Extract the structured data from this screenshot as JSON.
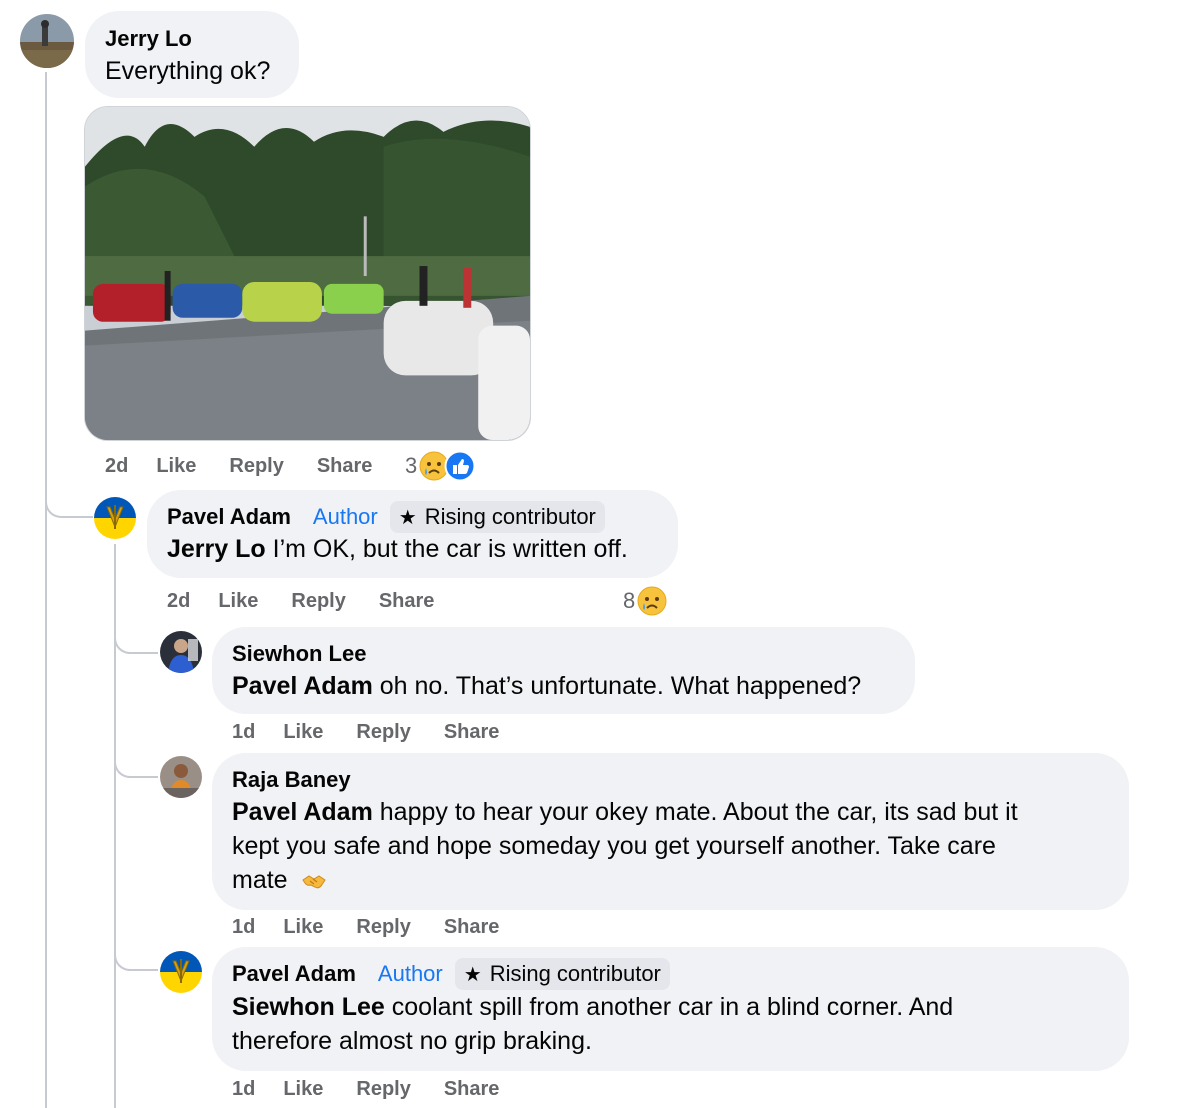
{
  "comments": [
    {
      "author": "Jerry Lo",
      "text": "Everything ok?",
      "time": "2d",
      "actions": [
        "Like",
        "Reply",
        "Share"
      ],
      "reaction_count": "3",
      "reactions": [
        "crying-face-icon",
        "like-icon"
      ]
    },
    {
      "author": "Pavel Adam",
      "author_tag": "Author",
      "badge": "Rising contributor",
      "mention": "Jerry Lo",
      "text": "I’m OK, but the car is written off.",
      "time": "2d",
      "actions": [
        "Like",
        "Reply",
        "Share"
      ],
      "reaction_count": "8",
      "reactions": [
        "crying-face-icon"
      ]
    },
    {
      "author": "Siewhon Lee",
      "mention": "Pavel Adam",
      "text": "oh no. That’s unfortunate. What happened?",
      "time": "1d",
      "actions": [
        "Like",
        "Reply",
        "Share"
      ]
    },
    {
      "author": "Raja Baney",
      "mention": "Pavel Adam",
      "text_lines": [
        "happy to hear your okey mate. About the car, its sad but it",
        "kept you safe and hope someday you get yourself another. Take care",
        "mate"
      ],
      "trailing_icon": "handshake-icon",
      "time": "1d",
      "actions": [
        "Like",
        "Reply",
        "Share"
      ]
    },
    {
      "author": "Pavel Adam",
      "author_tag": "Author",
      "badge": "Rising contributor",
      "mention": "Siewhon Lee",
      "text_lines": [
        "coolant spill from another car in a blind corner. And",
        "therefore almost no grip braking."
      ],
      "time": "1d",
      "actions": [
        "Like",
        "Reply",
        "Share"
      ]
    }
  ],
  "colors": {
    "bubble": "#f0f2f5",
    "action_text": "#65676b",
    "author_tag": "#1877f2",
    "badge_bg": "#e4e6eb",
    "thread_line": "#c7cbd1"
  }
}
